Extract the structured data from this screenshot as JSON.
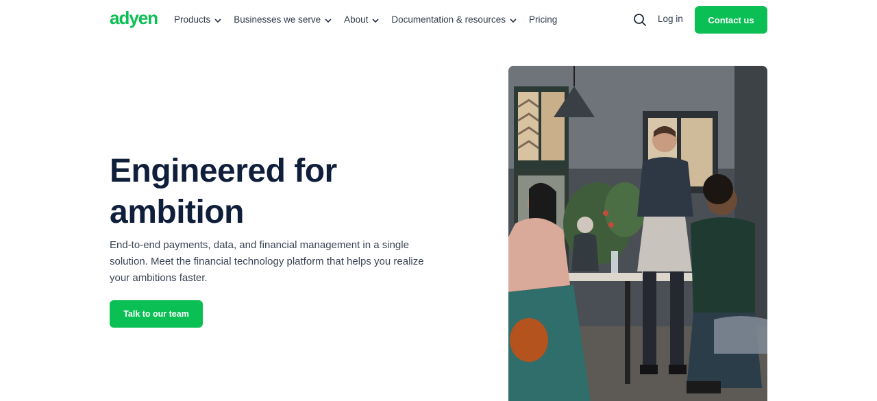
{
  "header": {
    "logo_text": "adyen",
    "nav": [
      {
        "label": "Products",
        "has_dropdown": true
      },
      {
        "label": "Businesses we serve",
        "has_dropdown": true
      },
      {
        "label": "About",
        "has_dropdown": true
      },
      {
        "label": "Documentation & resources",
        "has_dropdown": true
      },
      {
        "label": "Pricing",
        "has_dropdown": false
      }
    ],
    "search_icon": "search-icon",
    "login_label": "Log in",
    "contact_label": "Contact us"
  },
  "hero": {
    "title_line1": "Engineered for",
    "title_line2": "ambition",
    "description": "End-to-end payments, data, and financial management in a single solution. Meet the financial technology platform that helps you realize your ambitions faster.",
    "cta_label": "Talk to our team",
    "image_alt": "Restaurant scene with a server standing by a table of guests"
  },
  "colors": {
    "brand_green": "#0abf53",
    "heading": "#0f1e3a",
    "text": "#3a4454"
  }
}
